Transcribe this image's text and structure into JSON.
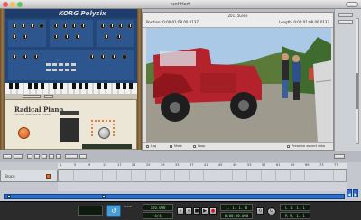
{
  "window": {
    "title": "unt.tled",
    "traffic_colors": [
      "#ef5b5b",
      "#f2c14e",
      "#5fc45a"
    ]
  },
  "rack": {
    "synth_brand": "KORG",
    "synth_model": "Polysix",
    "piano_name": "Radical Piano",
    "piano_subtitle": "GRAND UPRIGHT ELECTRIC"
  },
  "video": {
    "title": "20115Lens",
    "position_label": "Position: 0:00:01:08.00.0137",
    "length_label": "Length: 0:00:01:08.00.0137",
    "footer": {
      "log_label": "Log",
      "mute_label": "Mute",
      "loop_label": "Loop",
      "preserve_label": "Preserve aspect ratio"
    }
  },
  "sequencer": {
    "track_name": "Bruce",
    "ruler_numbers": [
      "1",
      "5",
      "9",
      "13",
      "17",
      "21",
      "25",
      "29",
      "33",
      "37",
      "41",
      "45",
      "49",
      "53",
      "57",
      "61",
      "65",
      "69",
      "73",
      "77"
    ]
  },
  "transport": {
    "tempo": "120.000",
    "signature": "4/4",
    "position": "1. 1. 1. 0",
    "time": "0:00:00:000",
    "left_locator": "L 1. 1. 1",
    "right_locator": "R 9. 1. 1",
    "click_label": "CLICK",
    "accent_color": "#4a9ed8"
  }
}
